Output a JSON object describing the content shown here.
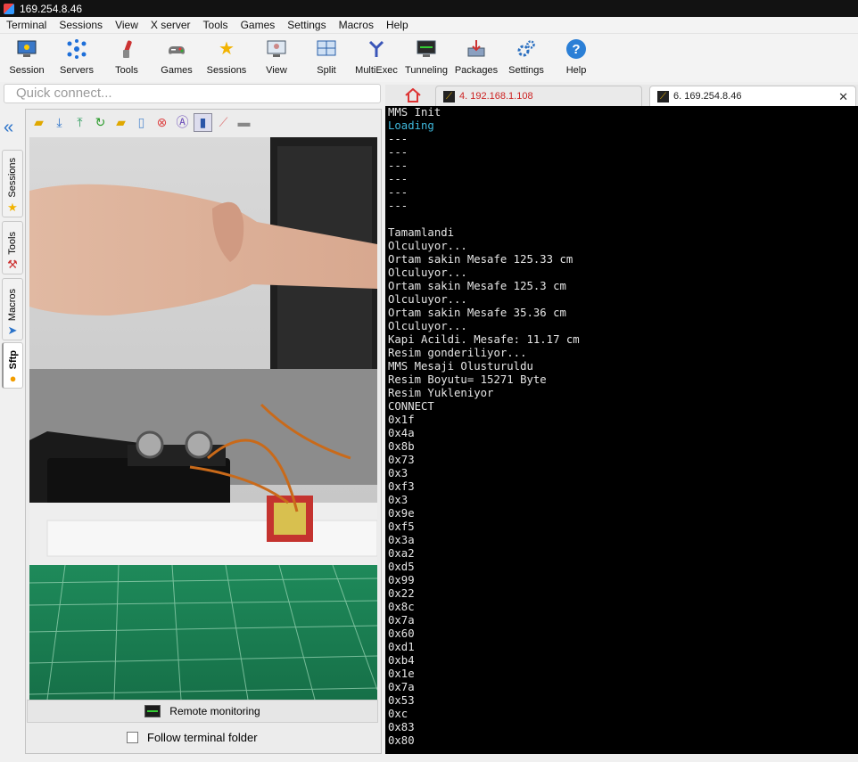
{
  "window": {
    "title": "169.254.8.46"
  },
  "menu": [
    "Terminal",
    "Sessions",
    "View",
    "X server",
    "Tools",
    "Games",
    "Settings",
    "Macros",
    "Help"
  ],
  "toolbar": [
    {
      "label": "Session",
      "icon": "session-icon"
    },
    {
      "label": "Servers",
      "icon": "servers-icon"
    },
    {
      "label": "Tools",
      "icon": "tools-icon"
    },
    {
      "label": "Games",
      "icon": "games-icon"
    },
    {
      "label": "Sessions",
      "icon": "sessions-star-icon"
    },
    {
      "label": "View",
      "icon": "view-icon"
    },
    {
      "label": "Split",
      "icon": "split-icon"
    },
    {
      "label": "MultiExec",
      "icon": "multiexec-icon"
    },
    {
      "label": "Tunneling",
      "icon": "tunneling-icon"
    },
    {
      "label": "Packages",
      "icon": "packages-icon"
    },
    {
      "label": "Settings",
      "icon": "settings-icon"
    },
    {
      "label": "Help",
      "icon": "help-icon"
    }
  ],
  "quick_connect": {
    "placeholder": "Quick connect..."
  },
  "tabs": [
    {
      "label": "4. 192.168.1.108"
    },
    {
      "label": "6. 169.254.8.46"
    }
  ],
  "side_tabs": [
    "Sessions",
    "Tools",
    "Macros",
    "Sftp"
  ],
  "sftp": {
    "remote_monitoring": "Remote monitoring",
    "follow_folder": "Follow terminal folder"
  },
  "terminal": {
    "lines": [
      "MMS Init",
      "Loading",
      "---",
      "---",
      "---",
      "---",
      "---",
      "---",
      "",
      "Tamamlandi",
      "Olculuyor...",
      "Ortam sakin Mesafe 125.33 cm",
      "Olculuyor...",
      "Ortam sakin Mesafe 125.3 cm",
      "Olculuyor...",
      "Ortam sakin Mesafe 35.36 cm",
      "Olculuyor...",
      "Kapi Acildi. Mesafe: 11.17 cm",
      "Resim gonderiliyor...",
      "MMS Mesaji Olusturuldu",
      "Resim Boyutu= 15271 Byte",
      "Resim Yukleniyor",
      "CONNECT",
      "0x1f",
      "0x4a",
      "0x8b",
      "0x73",
      "0x3",
      "0xf3",
      "0x3",
      "0x9e",
      "0xf5",
      "0x3a",
      "0xa2",
      "0xd5",
      "0x99",
      "0x22",
      "0x8c",
      "0x7a",
      "0x60",
      "0xd1",
      "0xb4",
      "0x1e",
      "0x7a",
      "0x53",
      "0xc",
      "0x83",
      "0x80"
    ],
    "cyan_line": 1
  },
  "colors": {
    "accent": "#2a72c9",
    "terminal_bg": "#000000",
    "terminal_fg": "#e6e6e6",
    "terminal_cyan": "#3fb9dd"
  }
}
